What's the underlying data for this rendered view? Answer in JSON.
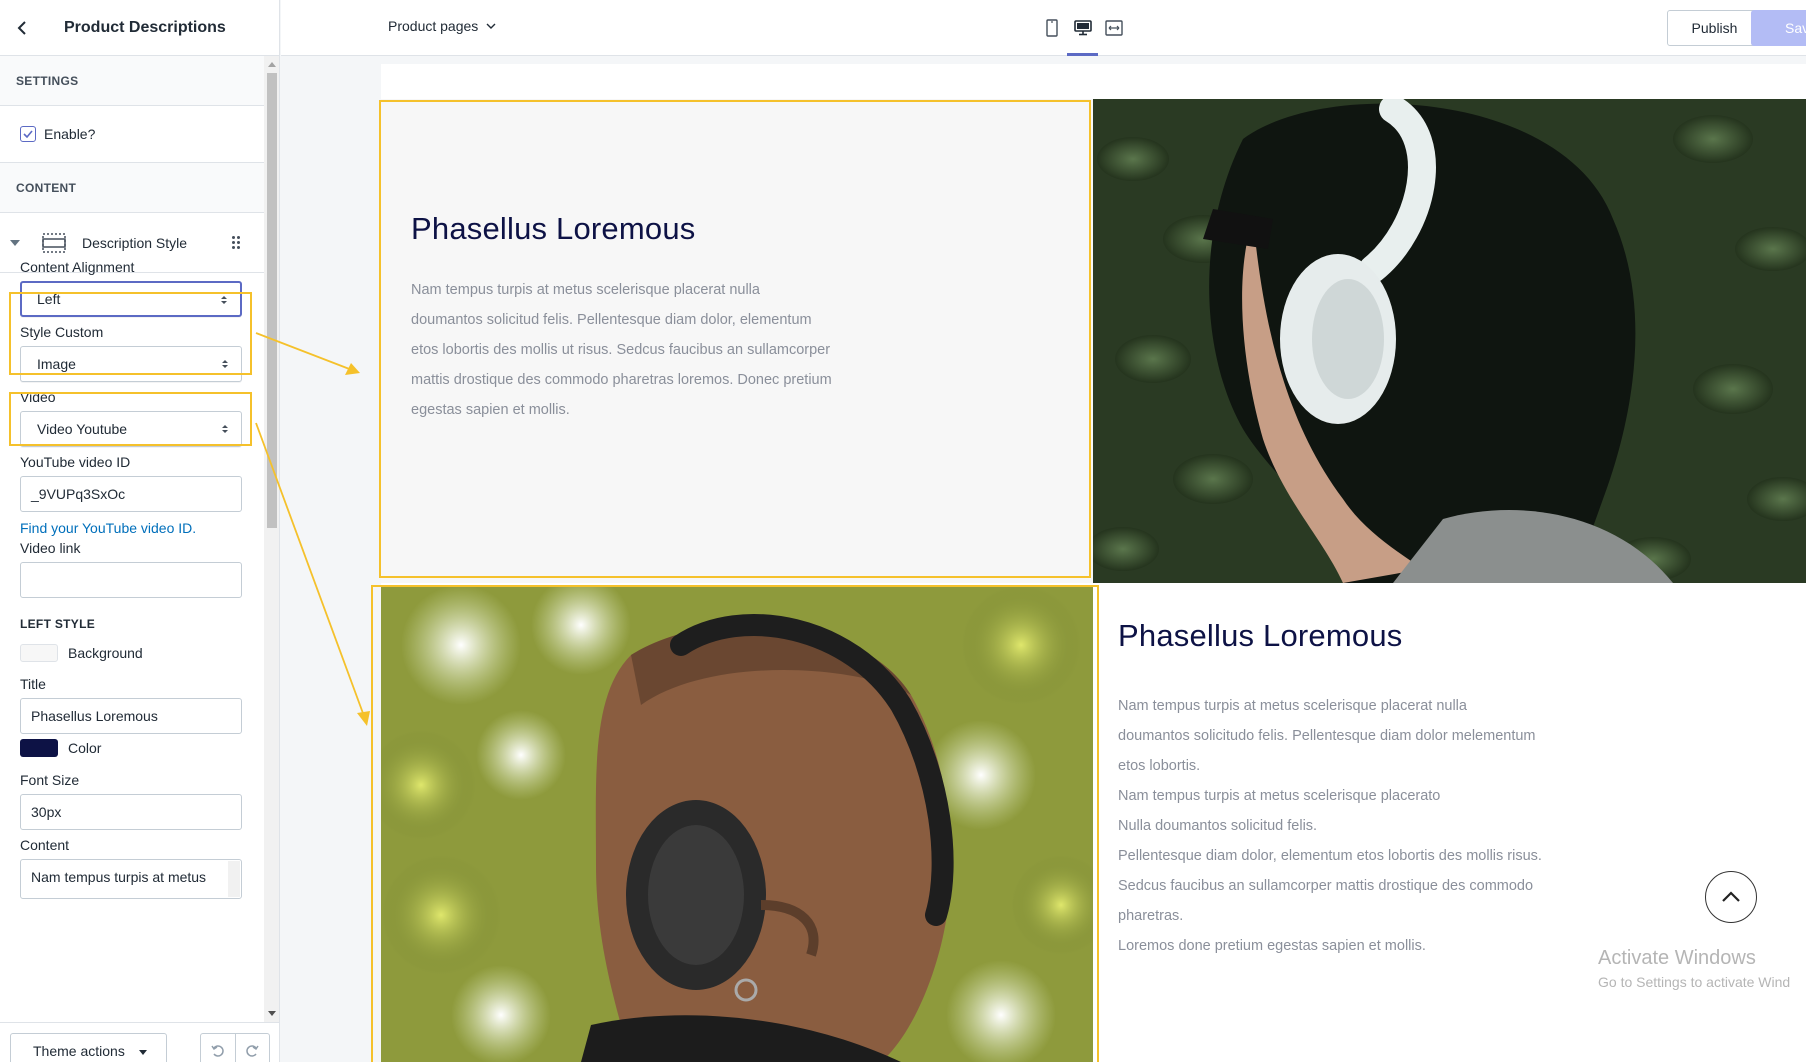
{
  "sidebar": {
    "title": "Product Descriptions",
    "settings_head": "SETTINGS",
    "enable_label": "Enable?",
    "content_head": "CONTENT",
    "block_label": "Description Style",
    "fields": {
      "content_alignment": {
        "label": "Content Alignment",
        "value": "Left"
      },
      "style_custom": {
        "label": "Style Custom",
        "value": "Image"
      },
      "video": {
        "label": "Video",
        "value": "Video Youtube"
      },
      "youtube_id": {
        "label": "YouTube video ID",
        "value": "_9VUPq3SxOc",
        "help": "Find your YouTube video ID."
      },
      "video_link": {
        "label": "Video link",
        "value": ""
      },
      "left_style_head": "LEFT STYLE",
      "background": {
        "label": "Background",
        "color": "#f7f7f7"
      },
      "title": {
        "label": "Title",
        "value": "Phasellus Loremous"
      },
      "color": {
        "label": "Color",
        "color": "#0d1245"
      },
      "font_size": {
        "label": "Font Size",
        "value": "30px"
      },
      "content": {
        "label": "Content",
        "value": "Nam tempus turpis at metus"
      }
    },
    "footer": {
      "theme_actions": "Theme actions"
    }
  },
  "topbar": {
    "page_select": "Product pages",
    "publish": "Publish",
    "save": "Save",
    "devices": [
      "mobile-icon",
      "desktop-icon",
      "fullscreen-icon"
    ],
    "active_device": "desktop-icon",
    "accent": "#5c6ac4"
  },
  "preview": {
    "block1": {
      "title": "Phasellus Loremous",
      "body": [
        "Nam tempus turpis at metus scelerisque placerat nulla",
        "doumantos solicitud felis. Pellentesque diam dolor, elementum",
        "etos lobortis des mollis ut risus. Sedcus faucibus an sullamcorper",
        "mattis drostique des commodo pharetras loremos. Donec pretium",
        "egestas sapien et mollis."
      ]
    },
    "block2": {
      "title": "Phasellus Loremous",
      "body": [
        "Nam tempus turpis at metus scelerisque placerat nulla",
        "doumantos solicitudo felis. Pellentesque diam dolor melementum",
        "etos lobortis.",
        "Nam tempus turpis at metus scelerisque placerato",
        "Nulla doumantos solicitud felis.",
        "Pellentesque diam dolor, elementum etos lobortis des mollis risus.",
        "Sedcus faucibus an sullamcorper mattis drostique des commodo",
        "pharetras.",
        "Loremos done pretium egestas sapien et mollis."
      ]
    },
    "watermark": {
      "line1": "Activate Windows",
      "line2": "Go to Settings to activate Wind"
    },
    "highlight_color": "#f5c12b"
  }
}
